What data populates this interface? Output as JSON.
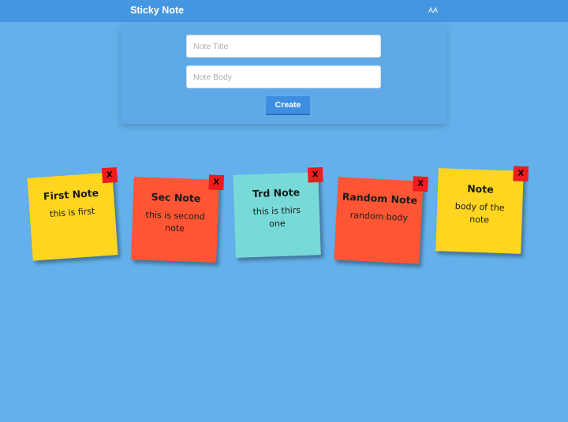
{
  "app": {
    "title": "Sticky Note",
    "user": "AA"
  },
  "form": {
    "title_placeholder": "Note Title",
    "body_placeholder": "Note Body",
    "create_label": "Create"
  },
  "notes": [
    {
      "title": "First Note",
      "body": "this is first",
      "close": "X",
      "color": "#ffd51f"
    },
    {
      "title": "Sec Note",
      "body": "this is second note",
      "close": "X",
      "color": "#fe5634"
    },
    {
      "title": "Trd Note",
      "body": "this is thirs one",
      "close": "X",
      "color": "#78dad8"
    },
    {
      "title": "Random Note",
      "body": "random body",
      "close": "X",
      "color": "#fe5634"
    },
    {
      "title": "Note",
      "body": "body of the note",
      "close": "X",
      "color": "#ffd51f"
    }
  ],
  "colors": {
    "background": "#63b0ea",
    "header": "#4596e0",
    "button": "#3d8ee0",
    "close": "#ee1c1c"
  }
}
